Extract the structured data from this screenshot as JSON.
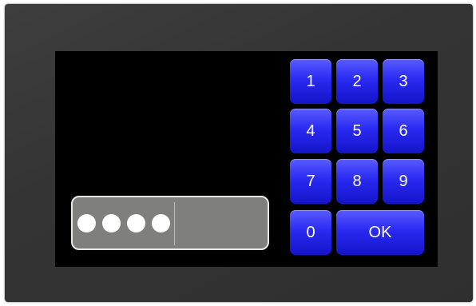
{
  "pin": {
    "digits_entered": 4,
    "dot_icon": "filled-circle"
  },
  "keypad": {
    "keys": [
      "1",
      "2",
      "3",
      "4",
      "5",
      "6",
      "7",
      "8",
      "9",
      "0"
    ],
    "ok_label": "OK"
  },
  "colors": {
    "key_blue": "#2a2af2",
    "display_gray": "#7f807d",
    "bezel": "#353535"
  }
}
